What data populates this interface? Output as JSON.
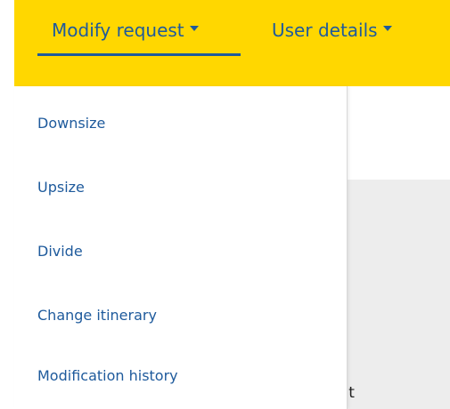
{
  "navbar": {
    "items": [
      {
        "label": "Modify request",
        "active": true
      },
      {
        "label": "User details",
        "active": false
      }
    ],
    "colors": {
      "background": "#ffd700",
      "link": "#1e5a9c"
    }
  },
  "dropdown": {
    "items": [
      {
        "label": "Downsize"
      },
      {
        "label": "Upsize"
      },
      {
        "label": "Divide"
      },
      {
        "label": "Change itinerary"
      },
      {
        "label": "Modification history"
      }
    ]
  },
  "background": {
    "partial_text": "ent"
  }
}
